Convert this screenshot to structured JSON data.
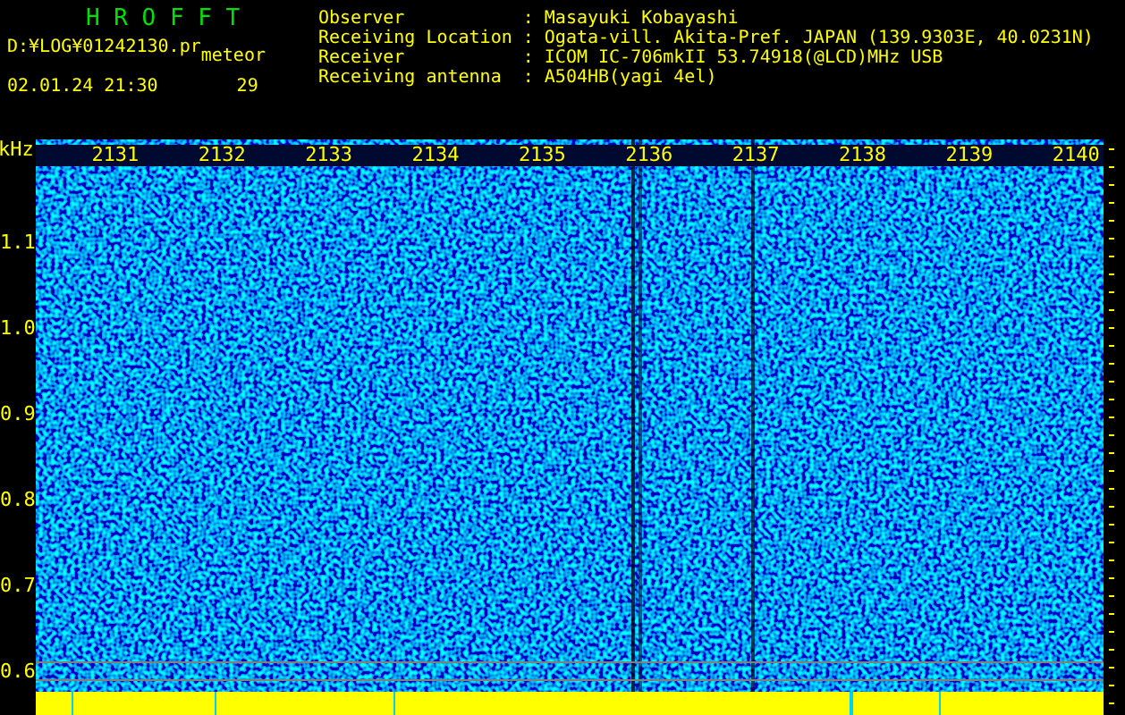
{
  "header": {
    "title": "H R O F F T",
    "file_path": "D:¥LOG¥01242130.pr",
    "mode": "meteor",
    "datetime": "02.01.24 21:30",
    "count": "29"
  },
  "info": [
    {
      "label": "Observer",
      "separator": ":",
      "value": "Masayuki Kobayashi"
    },
    {
      "label": "Receiving Location",
      "separator": ":",
      "value": "Ogata-vill. Akita-Pref. JAPAN (139.9303E, 40.0231N)"
    },
    {
      "label": "Receiver",
      "separator": ":",
      "value": "ICOM IC-706mkII 53.74918(@LCD)MHz USB"
    },
    {
      "label": "Receiving antenna",
      "separator": ":",
      "value": "A504HB(yagi 4el)"
    }
  ],
  "plot": {
    "unit": "kHz",
    "x_labels": [
      "2131",
      "2132",
      "2133",
      "2134",
      "2135",
      "2136",
      "2137",
      "2138",
      "2139",
      "2140"
    ],
    "y_labels": [
      "1.1",
      "1.0",
      "0.9",
      "0.8",
      "0.7",
      "0.6"
    ]
  }
}
